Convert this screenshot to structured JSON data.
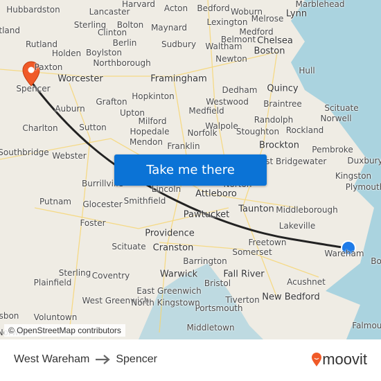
{
  "map": {
    "attribution": "© OpenStreetMap contributors",
    "towns": [
      "Hubbardston",
      "Harvard",
      "Acton",
      "Bedford",
      "Woburn",
      "Melrose",
      "Lynn",
      "Marblehead",
      "Lancaster",
      "Sterling",
      "Bolton",
      "Maynard",
      "Lexington",
      "Medford",
      "Clinton",
      "Rutland",
      "Berlin",
      "Sudbury",
      "Belmont",
      "Chelsea",
      "Holden",
      "Boylston",
      "Waltham",
      "Boston",
      "Paxton",
      "Northborough",
      "Newton",
      "Hull",
      "Worcester",
      "Framingham",
      "Quincy",
      "Spencer",
      "Hopkinton",
      "Dedham",
      "Grafton",
      "Westwood",
      "Braintree",
      "Scituate",
      "Auburn",
      "Upton",
      "Medfield",
      "Milford",
      "Walpole",
      "Randolph",
      "Norwell",
      "Charlton",
      "Sutton",
      "Hopedale",
      "Norfolk",
      "Stoughton",
      "Rockland",
      "Mendon",
      "Franklin",
      "Brockton",
      "Pembroke",
      "Southbridge",
      "Webster",
      "Duxbury",
      "Kingston",
      "Plymouth",
      "Burrillville",
      "Lincoln",
      "Attleboro",
      "Norton",
      "Putnam",
      "Glocester",
      "Smithfield",
      "Pawtucket",
      "Taunton",
      "Middleborough",
      "Foster",
      "Providence",
      "Lakeville",
      "Scituate",
      "Cranston",
      "Freetown",
      "Somerset",
      "Wareham",
      "Barrington",
      "Sterling",
      "Coventry",
      "Warwick",
      "Fall River",
      "Plainfield",
      "Bristol",
      "Acushnet",
      "West Greenwich",
      "East Greenwich",
      "Tiverton",
      "New Bedford",
      "Lisbon",
      "Voluntown",
      "Portsmouth",
      "North Kingstown",
      "Middletown",
      "Falmouth",
      "Norwich",
      "Bo",
      "Rutland",
      "West Bridgewater"
    ],
    "route_color": "#222222",
    "origin_marker_color": "#1e7be8",
    "destination_marker_color": "#f05a28"
  },
  "cta": {
    "label": "Take me there"
  },
  "footer": {
    "origin": "West Wareham",
    "destination": "Spencer",
    "arrow_icon": "arrow-right-icon",
    "logo_text": "moovit",
    "logo_color": "#f05a28"
  }
}
